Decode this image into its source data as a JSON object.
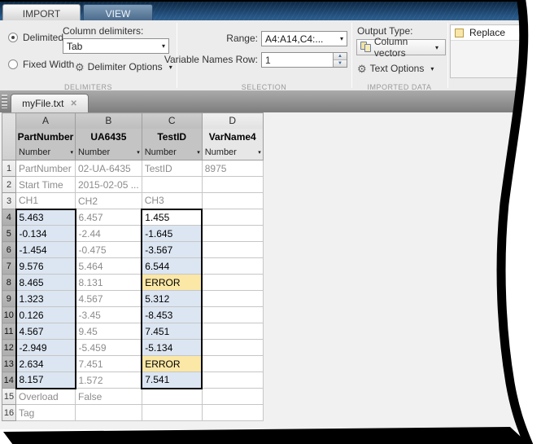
{
  "icons": {
    "dropdown": "▾",
    "gear": "⚙",
    "spin_up": "▲",
    "spin_down": "▼",
    "close": "✕"
  },
  "colors": {
    "selection_fill": "#dce6f2",
    "error_fill": "#fbe7a6",
    "header_selected": "#c4c4c4"
  },
  "ribbon": {
    "tabs": [
      {
        "label": "IMPORT"
      },
      {
        "label": "VIEW"
      }
    ],
    "delimiters": {
      "radio_delimited": "Delimited",
      "radio_fixed": "Fixed Width",
      "column_delimiters_label": "Column delimiters:",
      "delimiter_value": "Tab",
      "delimiter_options_label": "Delimiter Options",
      "section_label": "DELIMITERS"
    },
    "selection": {
      "range_label": "Range:",
      "range_value": "A4:A14,C4:...",
      "var_names_row_label": "Variable Names Row:",
      "var_names_row_value": "1",
      "section_label": "SELECTION"
    },
    "imported_data": {
      "output_type_label": "Output Type:",
      "output_type_value": "Column vectors",
      "text_options_label": "Text Options",
      "section_label": "IMPORTED DATA"
    },
    "unimportable_cells": {
      "replace_label": "Replace"
    }
  },
  "document_tab": {
    "title": "myFile.txt"
  },
  "grid": {
    "columns": [
      {
        "letter": "A",
        "name": "PartNumber",
        "type": "Number",
        "header_selected": true
      },
      {
        "letter": "B",
        "name": "UA6435",
        "type": "Number",
        "header_selected": true
      },
      {
        "letter": "C",
        "name": "TestID",
        "type": "Number",
        "header_selected": true
      },
      {
        "letter": "D",
        "name": "VarName4",
        "type": "Number",
        "header_selected": false
      }
    ],
    "rows": [
      [
        "PartNumber",
        "02-UA-6435",
        "TestID",
        "8975"
      ],
      [
        "Start Time",
        "2015-02-05 ...",
        "",
        ""
      ],
      [
        "CH1",
        "CH2",
        "CH3",
        ""
      ],
      [
        "5.463",
        "6.457",
        "1.455",
        ""
      ],
      [
        "-0.134",
        "-2.44",
        "-1.645",
        ""
      ],
      [
        "-1.454",
        "-0.475",
        "-3.567",
        ""
      ],
      [
        "9.576",
        "5.464",
        "6.544",
        ""
      ],
      [
        "8.465",
        "8.131",
        "ERROR",
        ""
      ],
      [
        "1.323",
        "4.567",
        "5.312",
        ""
      ],
      [
        "0.126",
        "-3.45",
        "-8.453",
        ""
      ],
      [
        "4.567",
        "9.45",
        "7.451",
        ""
      ],
      [
        "-2.949",
        "-5.459",
        "-5.134",
        ""
      ],
      [
        "2.634",
        "7.451",
        "ERROR",
        ""
      ],
      [
        "8.157",
        "1.572",
        "7.541",
        ""
      ],
      [
        "Overload",
        "False",
        "",
        ""
      ],
      [
        "Tag",
        "",
        "",
        ""
      ]
    ],
    "selection": {
      "ranges": [
        "A4:A14",
        "C4:C14"
      ],
      "active_cell": "C4"
    },
    "error_cells": [
      "C8",
      "C13"
    ]
  }
}
